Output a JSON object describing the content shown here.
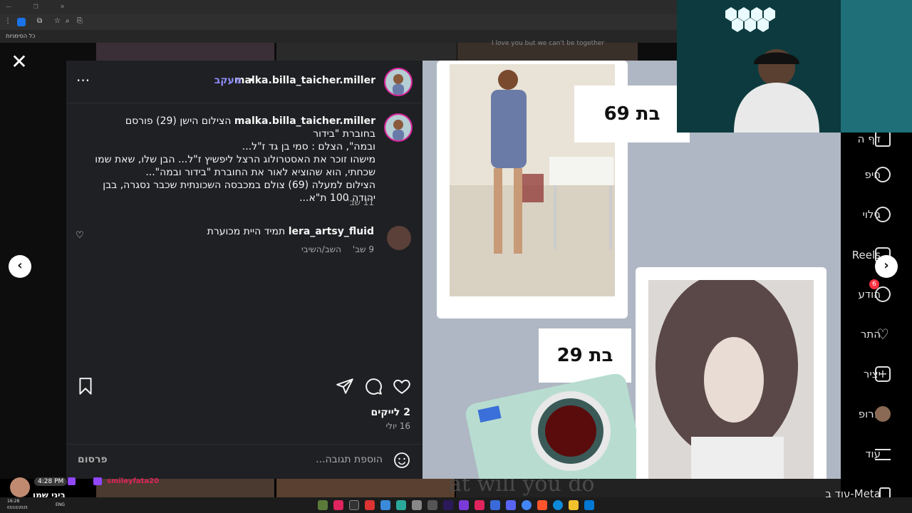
{
  "browser": {
    "bookmarks_label": "כל הסימניות"
  },
  "background": {
    "top_text": "I love you but we can't be together",
    "bottom_text": "at will you do"
  },
  "sidebar": {
    "items": [
      {
        "label": "דף ה",
        "icon": "home-icon"
      },
      {
        "label": "חיפ",
        "icon": "search-icon"
      },
      {
        "label": "גילוי",
        "icon": "compass-icon"
      },
      {
        "label": "Reels",
        "icon": "reels-icon"
      },
      {
        "label": "הודע",
        "icon": "messenger-icon",
        "badge": "6"
      },
      {
        "label": "התר",
        "icon": "heart-icon"
      },
      {
        "label": "יציר",
        "icon": "plus-icon"
      },
      {
        "label": "פרופ",
        "icon": "profile-icon"
      },
      {
        "label": "עוד",
        "icon": "menu-icon"
      },
      {
        "label": "עוד ב-Meta",
        "icon": "meta-icon"
      }
    ]
  },
  "post": {
    "author": "malka.billa_taicher.miller",
    "separator": "•",
    "follow_label": "מעקב",
    "caption_user": "malka.billa_taicher.miller",
    "caption_lines": [
      "הצילום הישן (29) פורסם בחוברת \"בידור",
      "ובמה\", הצלם : סמי בן גד ז\"ל...",
      "מישהו זוכר את האסטרולוג הרצל ליפשיץ ז\"ל... הבן שלו, שאת שמו",
      "שכחתי, הוא שהוציא לאור את החוברת \"בידור ובמה\"...",
      "הצילום למעלה (69) צולם במכבסה השכונתית שכבר נסגרה, בבן",
      "יהודה 100 ת\"א..."
    ],
    "caption_time": "11 שב'",
    "comments": [
      {
        "user": "lera_artsy_fluid",
        "text": "תמיד היית מכוערת",
        "time": "9 שב'",
        "reply": "השב/השיבי"
      }
    ],
    "likes": "2 לייקים",
    "date": "16 יולי",
    "comment_placeholder": "הוספת תגובה...",
    "post_button": "פרסום"
  },
  "photo": {
    "label_top": "בת 69",
    "label_bottom": "בת 29",
    "bg_color": "#aeb7c3"
  },
  "stream": {
    "time": "4:28 PM",
    "streamer_name": "ביגי שמן",
    "chat_user": "smileyfata20"
  },
  "taskbar": {
    "clock": "16:28",
    "date": "03/10/2025",
    "lang": "ENG"
  }
}
